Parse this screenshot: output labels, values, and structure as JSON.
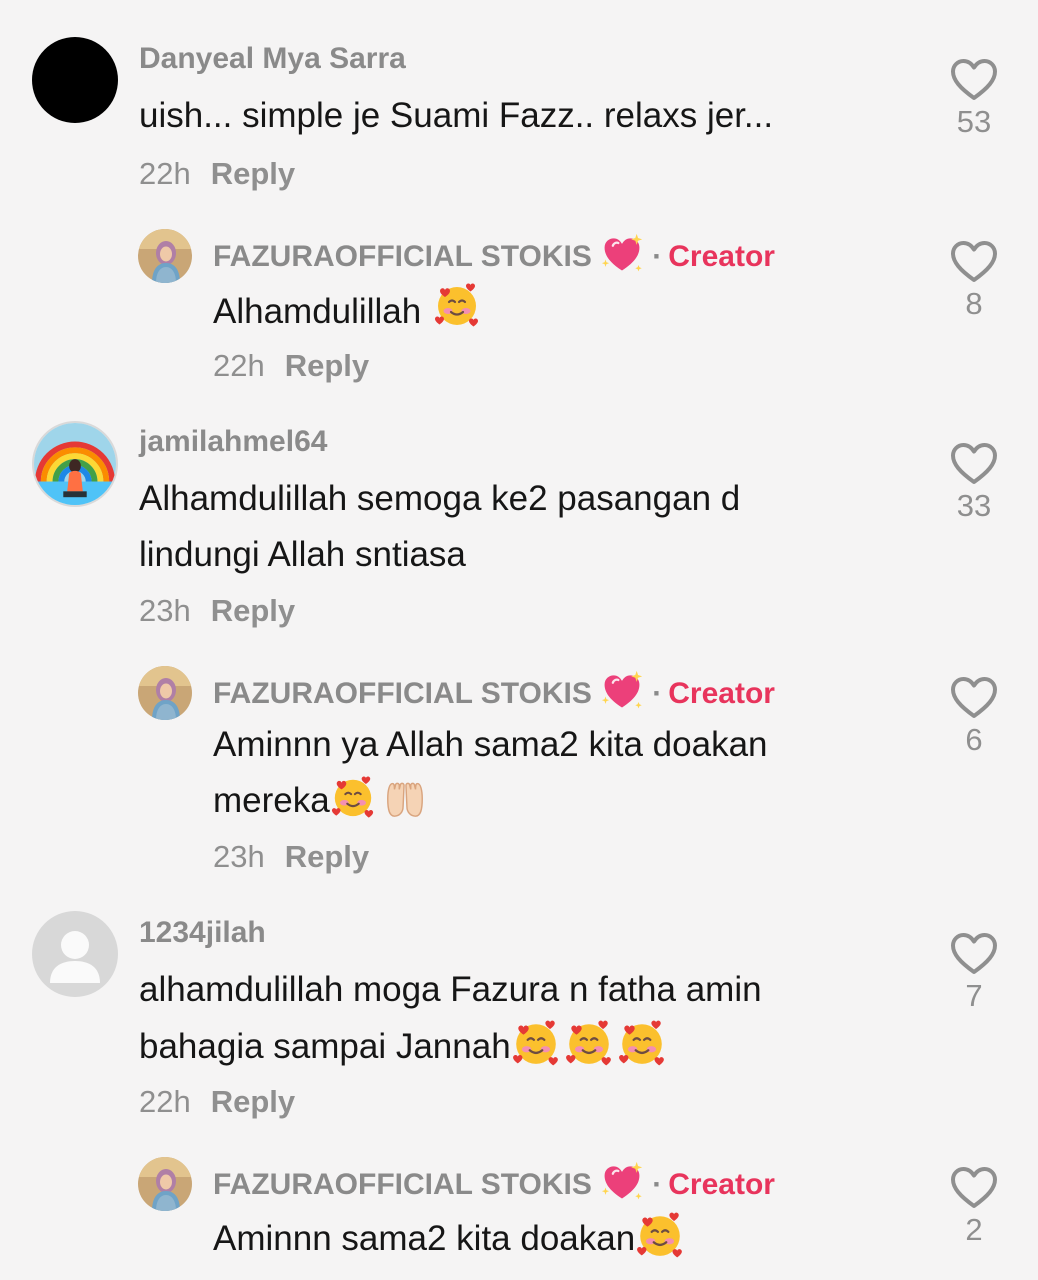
{
  "comments": [
    {
      "username": "Danyeal Mya Sarra",
      "text_lines": [
        "uish... simple je Suami Fazz.. relaxs jer..."
      ],
      "time": "22h",
      "reply_label": "Reply",
      "likes": "53",
      "avatar_icon": "black-circle-avatar"
    },
    {
      "username": "FAZURAOFFICIAL STOKIS",
      "badge_icon": "sparkling-heart-emoji",
      "creator_label": "Creator",
      "text_lines": [
        "Alhamdulillah"
      ],
      "emojis": [
        "smiling-face-with-hearts-emoji"
      ],
      "time": "22h",
      "reply_label": "Reply",
      "likes": "8"
    },
    {
      "username": "jamilahmel64",
      "text_lines": [
        "Alhamdulillah semoga ke2 pasangan d",
        "lindungi Allah sntiasa"
      ],
      "time": "23h",
      "reply_label": "Reply",
      "likes": "33"
    },
    {
      "username": "FAZURAOFFICIAL STOKIS",
      "badge_icon": "sparkling-heart-emoji",
      "creator_label": "Creator",
      "text_lines": [
        "Aminnn ya Allah sama2 kita doakan",
        "mereka"
      ],
      "emojis": [
        "smiling-face-with-hearts-emoji",
        "raised-hands-emoji"
      ],
      "time": "23h",
      "reply_label": "Reply",
      "likes": "6"
    },
    {
      "username": "1234jilah",
      "text_lines": [
        "alhamdulillah moga Fazura n fatha amin",
        "bahagia sampai Jannah"
      ],
      "emojis": [
        "smiling-face-with-hearts-emoji",
        "smiling-face-with-hearts-emoji",
        "smiling-face-with-hearts-emoji"
      ],
      "time": "22h",
      "reply_label": "Reply",
      "likes": "7",
      "avatar_icon": "default-user-avatar"
    },
    {
      "username": "FAZURAOFFICIAL STOKIS",
      "badge_icon": "sparkling-heart-emoji",
      "creator_label": "Creator",
      "text_lines": [
        "Aminnn sama2 kita doakan"
      ],
      "emojis": [
        "smiling-face-with-hearts-emoji"
      ],
      "likes": "2"
    }
  ],
  "colors": {
    "background": "#f5f4f4",
    "username": "#8a8a8a",
    "creator": "#e8345c",
    "text": "#161616",
    "muted": "#8f8f8f"
  }
}
